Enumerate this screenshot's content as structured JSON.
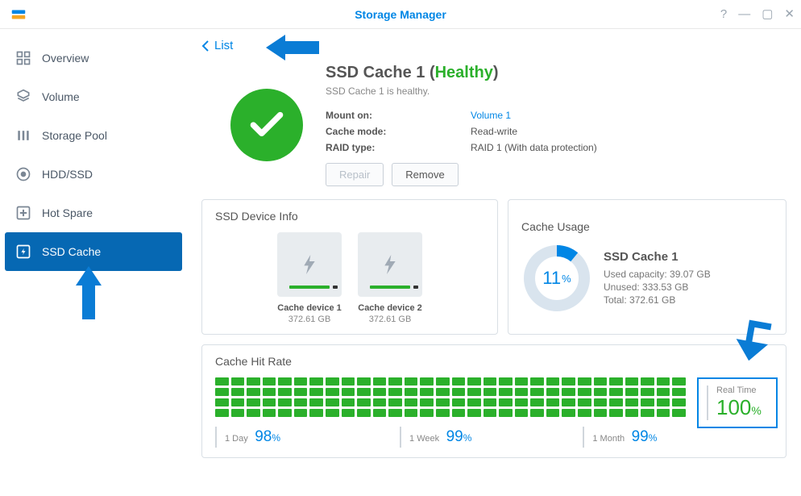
{
  "window": {
    "title": "Storage Manager"
  },
  "sidebar": {
    "items": [
      {
        "label": "Overview"
      },
      {
        "label": "Volume"
      },
      {
        "label": "Storage Pool"
      },
      {
        "label": "HDD/SSD"
      },
      {
        "label": "Hot Spare"
      },
      {
        "label": "SSD Cache"
      }
    ]
  },
  "back": {
    "label": "List"
  },
  "header": {
    "title_prefix": "SSD Cache 1 (",
    "title_status": "Healthy",
    "title_suffix": ")",
    "subtitle": "SSD Cache 1 is healthy.",
    "rows": [
      {
        "label": "Mount on:",
        "value": "Volume 1",
        "link": true
      },
      {
        "label": "Cache mode:",
        "value": "Read-write"
      },
      {
        "label": "RAID type:",
        "value": "RAID 1 (With data protection)"
      }
    ],
    "repair": "Repair",
    "remove": "Remove"
  },
  "device_panel": {
    "title": "SSD Device Info",
    "devices": [
      {
        "name": "Cache device 1",
        "size": "372.61 GB"
      },
      {
        "name": "Cache device 2",
        "size": "372.61 GB"
      }
    ]
  },
  "usage_panel": {
    "title": "Cache Usage",
    "percent": "11",
    "percent_suffix": "%",
    "name": "SSD Cache 1",
    "used_label": "Used capacity: ",
    "used": "39.07 GB",
    "unused_label": "Unused: ",
    "unused": "333.53 GB",
    "total_label": "Total: ",
    "total": "372.61 GB"
  },
  "hitrate": {
    "title": "Cache Hit Rate",
    "stats": [
      {
        "label": "1 Day",
        "value": "98",
        "suffix": "%"
      },
      {
        "label": "1 Week",
        "value": "99",
        "suffix": "%"
      },
      {
        "label": "1 Month",
        "value": "99",
        "suffix": "%"
      }
    ],
    "realtime_label": "Real Time",
    "realtime_value": "100",
    "realtime_suffix": "%"
  }
}
